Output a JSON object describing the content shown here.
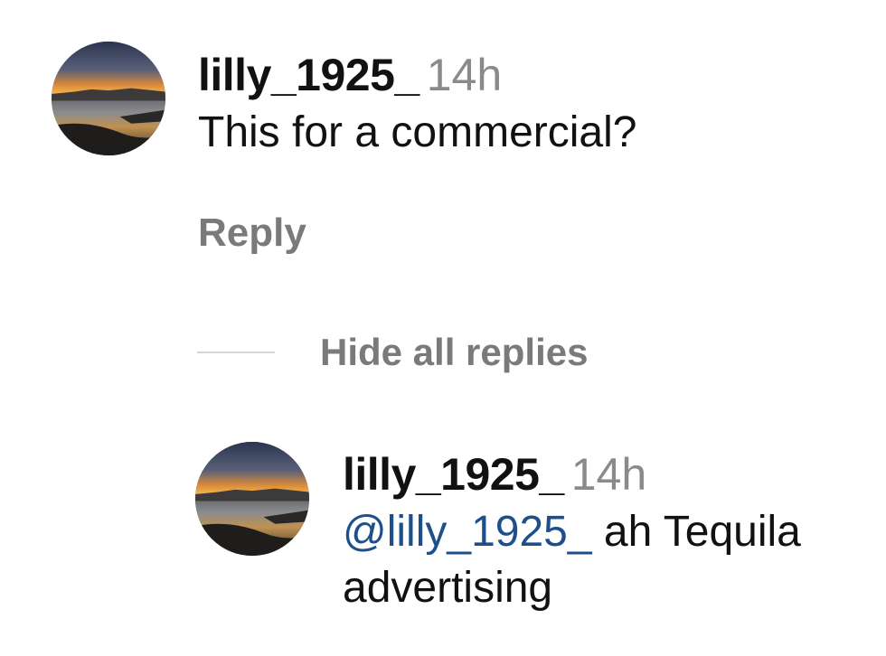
{
  "comment": {
    "username": "lilly_1925_",
    "timestamp": "14h",
    "text": "This for a commercial?",
    "reply_label": "Reply"
  },
  "replies_toggle": {
    "label": "Hide all replies"
  },
  "reply": {
    "username": "lilly_1925_",
    "timestamp": "14h",
    "mention": "@lilly_1925_",
    "text_line1": " ah Tequila",
    "text_line2": "advertising"
  },
  "colors": {
    "mention": "#1d4f8a",
    "muted": "#7a7a7a",
    "timestamp": "#8a8a8a"
  },
  "icons": {
    "avatar": "sunset-landscape-avatar"
  }
}
